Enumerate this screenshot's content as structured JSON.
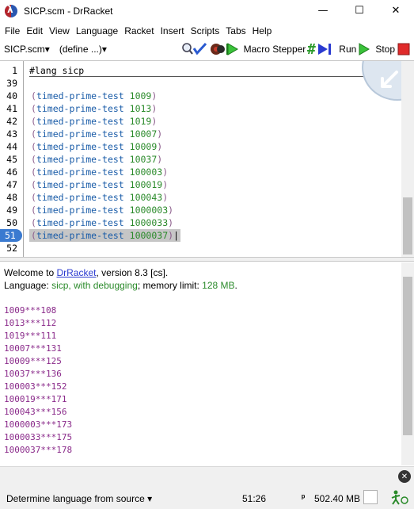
{
  "window": {
    "title": "SICP.scm - DrRacket",
    "minimize": "—",
    "maximize": "☐",
    "close": "✕"
  },
  "menu": [
    "File",
    "Edit",
    "View",
    "Language",
    "Racket",
    "Insert",
    "Scripts",
    "Tabs",
    "Help"
  ],
  "toolbar": {
    "file_label": "SICP.scm▾",
    "define_label": "(define ...)▾",
    "macro_stepper_label": "Macro Stepper",
    "run_label": "Run",
    "stop_label": "Stop"
  },
  "definitions": {
    "lines": [
      {
        "num": "1",
        "text": "#lang sicp"
      },
      {
        "num": "39",
        "text": ""
      },
      {
        "num": "40",
        "fn": "timed-prime-test",
        "arg": "1009"
      },
      {
        "num": "41",
        "fn": "timed-prime-test",
        "arg": "1013"
      },
      {
        "num": "42",
        "fn": "timed-prime-test",
        "arg": "1019"
      },
      {
        "num": "43",
        "fn": "timed-prime-test",
        "arg": "10007"
      },
      {
        "num": "44",
        "fn": "timed-prime-test",
        "arg": "10009"
      },
      {
        "num": "45",
        "fn": "timed-prime-test",
        "arg": "10037"
      },
      {
        "num": "46",
        "fn": "timed-prime-test",
        "arg": "100003"
      },
      {
        "num": "47",
        "fn": "timed-prime-test",
        "arg": "100019"
      },
      {
        "num": "48",
        "fn": "timed-prime-test",
        "arg": "100043"
      },
      {
        "num": "49",
        "fn": "timed-prime-test",
        "arg": "1000003"
      },
      {
        "num": "50",
        "fn": "timed-prime-test",
        "arg": "1000033"
      },
      {
        "num": "51",
        "fn": "timed-prime-test",
        "arg": "1000037"
      },
      {
        "num": "52",
        "text": ""
      }
    ]
  },
  "interactions": {
    "welcome_prefix": "Welcome to ",
    "welcome_link": "DrRacket",
    "welcome_suffix": ", version 8.3 [cs].",
    "language_prefix": "Language: ",
    "language_value": "sicp, with debugging",
    "memory_prefix": "; memory limit: ",
    "memory_value": "128 MB",
    "memory_suffix": ".",
    "output": [
      "1009***108",
      "1013***112",
      "1019***111",
      "10007***131",
      "10009***125",
      "10037***136",
      "100003***152",
      "100019***171",
      "100043***156",
      "1000003***173",
      "1000033***175",
      "1000037***178"
    ]
  },
  "status": {
    "language": "Determine language from source ▾",
    "position": "51:26",
    "memory": "502.40 MB"
  },
  "icons": {
    "app": "drracket-icon",
    "check_syntax": "magnifier-check-icon",
    "debug": "bug-debug-icon",
    "macro_stepper": "hash-step-icon",
    "run": "green-play-icon",
    "stop": "red-stop-icon",
    "gc": "recycle-runner-icon"
  },
  "colors": {
    "paren": "#8a5a8a",
    "keyword": "#1a5ca8",
    "number": "#2a8a2a",
    "output": "#8a2a8a",
    "link": "#2a3ad0"
  }
}
